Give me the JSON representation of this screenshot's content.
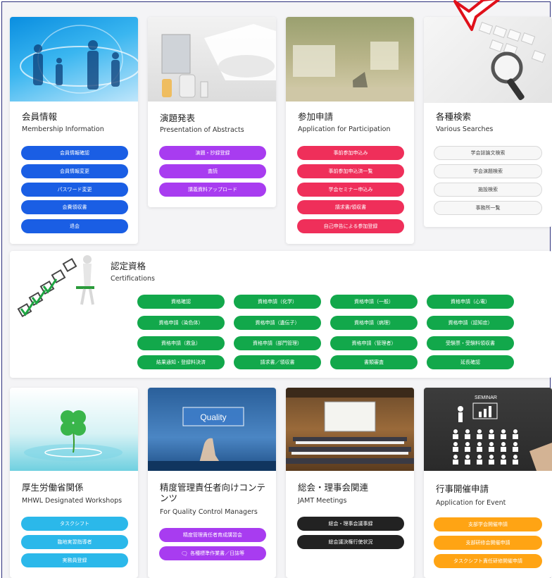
{
  "colors": {
    "blue": "#1a5ee4",
    "purple": "#a83cf0",
    "red": "#ef2f5a",
    "gray": "#f7f7f7",
    "green": "#12a84b",
    "cyan": "#2bb8ea",
    "black": "#222222",
    "orange": "#ffa414",
    "frame": "#2b2f7c",
    "arrow": "#e0101a"
  },
  "membership": {
    "title": "会員情報",
    "subtitle": "Membership Information",
    "buttons": [
      "会員情報確認",
      "会員情報変更",
      "パスワード変更",
      "会費領収書",
      "退会"
    ]
  },
  "abstracts": {
    "title": "演題発表",
    "subtitle": "Presentation of Abstracts",
    "buttons": [
      "演題・抄録登録",
      "査読",
      "講義資料アップロード"
    ]
  },
  "participation": {
    "title": "参加申請",
    "subtitle": "Application for Participation",
    "buttons": [
      "事前参加申込み",
      "事前参加申込済一覧",
      "学会セミナー申込み",
      "請求書/領収書",
      "自己申告による参加登録"
    ]
  },
  "searches": {
    "title": "各種検索",
    "subtitle": "Various Searches",
    "buttons": [
      "学会誌論文検索",
      "学会演題検索",
      "施設検索",
      "事務所一覧"
    ]
  },
  "certifications": {
    "title": "認定資格",
    "subtitle": "Certifications",
    "buttons": [
      "資格確認",
      "資格申請（化学）",
      "資格申請（一般）",
      "資格申請（心電）",
      "資格申請（染色体）",
      "資格申請（遺伝子）",
      "資格申請（病理）",
      "資格申請（認知症）",
      "資格申請（救急）",
      "資格申請（部門管理）",
      "資格申請（管理者）",
      "受験票・受験料領収書",
      "結果通知・登録料決済",
      "請求書／領収書",
      "書類審査",
      "延長確認"
    ]
  },
  "mhwl": {
    "title": "厚生労働省関係",
    "subtitle": "MHWL Designated Workshops",
    "buttons": [
      "タスクシフト",
      "臨地実習指導者",
      "実務員登録"
    ]
  },
  "quality": {
    "title_line1": "精度管理責任者向けコンテ",
    "title_line2": "ンツ",
    "subtitle": "For Quality Control Managers",
    "image_label": "Quality",
    "buttons": [
      "精度管理責任者育成講習会",
      "各種標準作業書／日誌等"
    ]
  },
  "meetings": {
    "title": "総会・理事会関連",
    "subtitle": "JAMT Meetings",
    "buttons": [
      "総会・理事会議事録",
      "総会議決権行使状況"
    ]
  },
  "event": {
    "title": "行事開催申請",
    "subtitle": "Application for Event",
    "image_label": "SEMINAR",
    "buttons": [
      "支部学会開催申請",
      "支部研修会開催申請",
      "タスクシフト責任研修開催申請"
    ]
  }
}
